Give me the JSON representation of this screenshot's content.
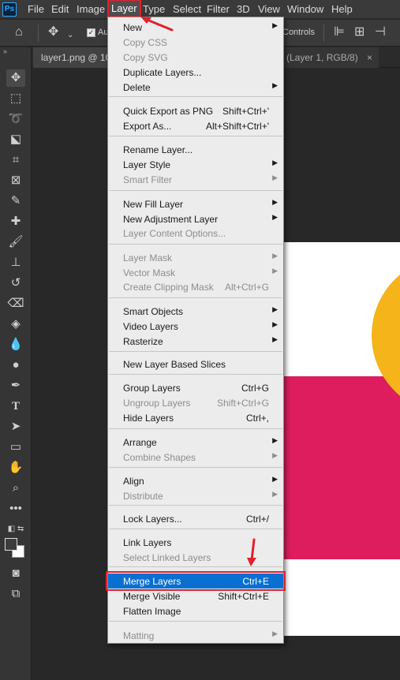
{
  "app": {
    "logo": "Ps"
  },
  "menubar": {
    "items": [
      "File",
      "Edit",
      "Image",
      "Layer",
      "Type",
      "Select",
      "Filter",
      "3D",
      "View",
      "Window",
      "Help"
    ]
  },
  "options": {
    "auto_label": "Au",
    "controls_label": "Controls",
    "check_mark": "✓"
  },
  "tabs": [
    {
      "label": "layer1.png @ 10"
    },
    {
      "label": "(Layer 1, RGB/8)",
      "close": "×"
    }
  ],
  "layer_menu": {
    "items": [
      {
        "label": "New",
        "shortcut": "",
        "submenu": true,
        "disabled": false
      },
      {
        "label": "Copy CSS",
        "shortcut": "",
        "submenu": false,
        "disabled": true
      },
      {
        "label": "Copy SVG",
        "shortcut": "",
        "submenu": false,
        "disabled": true
      },
      {
        "label": "Duplicate Layers...",
        "shortcut": "",
        "submenu": false,
        "disabled": false
      },
      {
        "label": "Delete",
        "shortcut": "",
        "submenu": true,
        "disabled": false
      },
      {
        "label": "Quick Export as PNG",
        "shortcut": "Shift+Ctrl+'",
        "submenu": false,
        "disabled": false
      },
      {
        "label": "Export As...",
        "shortcut": "Alt+Shift+Ctrl+'",
        "submenu": false,
        "disabled": false
      },
      {
        "label": "Rename Layer...",
        "shortcut": "",
        "submenu": false,
        "disabled": false
      },
      {
        "label": "Layer Style",
        "shortcut": "",
        "submenu": true,
        "disabled": false
      },
      {
        "label": "Smart Filter",
        "shortcut": "",
        "submenu": true,
        "disabled": true
      },
      {
        "label": "New Fill Layer",
        "shortcut": "",
        "submenu": true,
        "disabled": false
      },
      {
        "label": "New Adjustment Layer",
        "shortcut": "",
        "submenu": true,
        "disabled": false
      },
      {
        "label": "Layer Content Options...",
        "shortcut": "",
        "submenu": false,
        "disabled": true
      },
      {
        "label": "Layer Mask",
        "shortcut": "",
        "submenu": true,
        "disabled": true
      },
      {
        "label": "Vector Mask",
        "shortcut": "",
        "submenu": true,
        "disabled": true
      },
      {
        "label": "Create Clipping Mask",
        "shortcut": "Alt+Ctrl+G",
        "submenu": false,
        "disabled": true
      },
      {
        "label": "Smart Objects",
        "shortcut": "",
        "submenu": true,
        "disabled": false
      },
      {
        "label": "Video Layers",
        "shortcut": "",
        "submenu": true,
        "disabled": false
      },
      {
        "label": "Rasterize",
        "shortcut": "",
        "submenu": true,
        "disabled": false
      },
      {
        "label": "New Layer Based Slices",
        "shortcut": "",
        "submenu": false,
        "disabled": false
      },
      {
        "label": "Group Layers",
        "shortcut": "Ctrl+G",
        "submenu": false,
        "disabled": false
      },
      {
        "label": "Ungroup Layers",
        "shortcut": "Shift+Ctrl+G",
        "submenu": false,
        "disabled": true
      },
      {
        "label": "Hide Layers",
        "shortcut": "Ctrl+,",
        "submenu": false,
        "disabled": false
      },
      {
        "label": "Arrange",
        "shortcut": "",
        "submenu": true,
        "disabled": false
      },
      {
        "label": "Combine Shapes",
        "shortcut": "",
        "submenu": true,
        "disabled": true
      },
      {
        "label": "Align",
        "shortcut": "",
        "submenu": true,
        "disabled": false
      },
      {
        "label": "Distribute",
        "shortcut": "",
        "submenu": true,
        "disabled": true
      },
      {
        "label": "Lock Layers...",
        "shortcut": "Ctrl+/",
        "submenu": false,
        "disabled": false
      },
      {
        "label": "Link Layers",
        "shortcut": "",
        "submenu": false,
        "disabled": false
      },
      {
        "label": "Select Linked Layers",
        "shortcut": "",
        "submenu": false,
        "disabled": true
      },
      {
        "label": "Merge Layers",
        "shortcut": "Ctrl+E",
        "submenu": false,
        "disabled": false,
        "highlighted": true
      },
      {
        "label": "Merge Visible",
        "shortcut": "Shift+Ctrl+E",
        "submenu": false,
        "disabled": false
      },
      {
        "label": "Flatten Image",
        "shortcut": "",
        "submenu": false,
        "disabled": false
      },
      {
        "label": "Matting",
        "shortcut": "",
        "submenu": true,
        "disabled": true
      }
    ],
    "submenu_arrow": "▶"
  },
  "colors": {
    "highlight": "#0a6fd1",
    "annotation_red": "#e0212e",
    "canvas_pink": "#dd1d5e",
    "canvas_yellow": "#f4b41a"
  }
}
